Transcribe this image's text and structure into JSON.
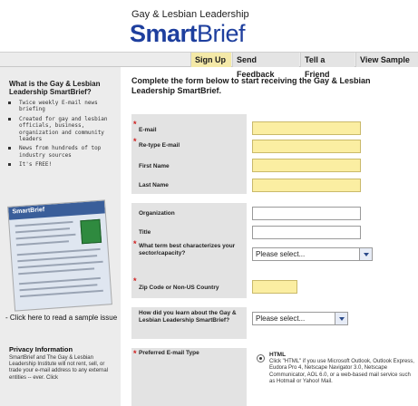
{
  "header": {
    "brand_small": "Gay & Lesbian Leadership",
    "brand_bold": "Smart",
    "brand_light": "Brief"
  },
  "nav": {
    "items": [
      {
        "label": "Sign Up"
      },
      {
        "label": "Send Feedback"
      },
      {
        "label": "Tell a Friend"
      },
      {
        "label": "View Sample"
      }
    ]
  },
  "sidebar": {
    "title": "What is the Gay & Lesbian Leadership SmartBrief?",
    "bullets": [
      "Twice weekly E-mail news briefing",
      "Created for gay and lesbian officials, business, organization and community leaders",
      "News from hundreds of top industry sources",
      "It's FREE!"
    ],
    "sample_image_logo": "SmartBrief",
    "sample_link": "- Click here to read a sample issue",
    "privacy_title": "Privacy Information",
    "privacy_text": "SmartBrief and The Gay & Lesbian Leadership Institute will not rent, sell, or trade your e-mail address to any external entities -- ever. Click"
  },
  "main": {
    "title": "Complete the form below to start receiving the Gay & Lesbian Leadership SmartBrief.",
    "fields": {
      "email": {
        "label": "E-mail",
        "value": "",
        "placeholder": ""
      },
      "retype_email": {
        "label": "Re-type E-mail",
        "value": "",
        "placeholder": ""
      },
      "first_name": {
        "label": "First Name",
        "value": "",
        "placeholder": ""
      },
      "last_name": {
        "label": "Last Name",
        "value": "",
        "placeholder": ""
      },
      "organization": {
        "label": "Organization",
        "value": "",
        "placeholder": ""
      },
      "title": {
        "label": "Title",
        "value": "",
        "placeholder": ""
      },
      "sector": {
        "label": "What term best characterizes your sector/capacity?",
        "selected": "Please select..."
      },
      "zip": {
        "label": "Zip Code or Non-US Country",
        "value": "",
        "placeholder": ""
      },
      "referral": {
        "label": "How did you learn about the Gay & Lesbian Leadership SmartBrief?",
        "selected": "Please select..."
      },
      "email_type": {
        "label": "Preferred E-mail Type",
        "option_title": "HTML",
        "option_desc": "Click \"HTML\" if you use Microsoft Outlook, Outlook Express, Eudora Pro 4, Netscape Navigator 3.0, Netscape Communicator, AOL 6.0, or a web-based mail service such as Hotmail or Yahoo! Mail."
      }
    },
    "required_marker": "*"
  },
  "colors": {
    "brand_blue": "#1e3f9e",
    "required_field": "#fbeea2",
    "active_tab": "#f4e9a8",
    "required_marker": "#d01d1d"
  }
}
